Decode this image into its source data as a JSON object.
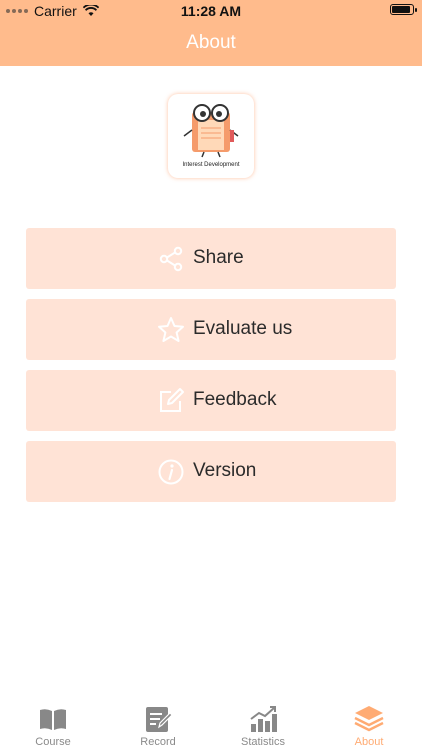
{
  "status_bar": {
    "carrier": "Carrier",
    "time": "11:28 AM"
  },
  "nav": {
    "title": "About"
  },
  "app_logo": {
    "caption": "Interest Development"
  },
  "menu": [
    {
      "label": "Share",
      "icon": "share-icon"
    },
    {
      "label": "Evaluate us",
      "icon": "star-icon"
    },
    {
      "label": "Feedback",
      "icon": "edit-icon"
    },
    {
      "label": "Version",
      "icon": "info-icon"
    }
  ],
  "tabbar": {
    "items": [
      {
        "label": "Course",
        "icon": "book-icon"
      },
      {
        "label": "Record",
        "icon": "record-icon"
      },
      {
        "label": "Statistics",
        "icon": "statistics-icon"
      },
      {
        "label": "About",
        "icon": "layers-icon",
        "active": true
      }
    ]
  },
  "colors": {
    "header": "#ffbb8c",
    "button_bg": "#ffe3d6",
    "active_tab": "#ffab73",
    "inactive_tab": "#8a8a8a"
  }
}
